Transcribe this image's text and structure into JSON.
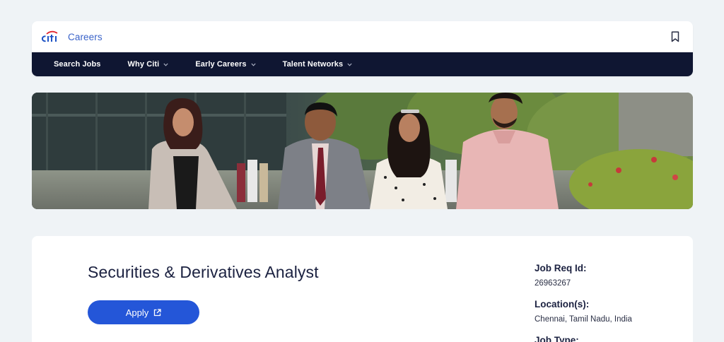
{
  "header": {
    "careers_label": "Careers",
    "logo_text": "citi"
  },
  "nav": {
    "items": [
      {
        "label": "Search Jobs",
        "has_dropdown": false
      },
      {
        "label": "Why Citi",
        "has_dropdown": true
      },
      {
        "label": "Early Careers",
        "has_dropdown": true
      },
      {
        "label": "Talent Networks",
        "has_dropdown": true
      }
    ]
  },
  "job": {
    "title": "Securities & Derivatives Analyst",
    "apply_label": "Apply",
    "meta": [
      {
        "label": "Job Req Id:",
        "value": "26963267"
      },
      {
        "label": "Location(s):",
        "value": "Chennai, Tamil Nadu, India"
      },
      {
        "label": "Job Type:",
        "value": ""
      }
    ]
  },
  "icons": {
    "bookmark": "bookmark-icon",
    "chevron": "chevron-down-icon",
    "external": "external-link-icon"
  },
  "colors": {
    "background": "#eff3f6",
    "nav_bg": "#0f1632",
    "brand_blue": "#2456d8",
    "careers_blue": "#3a63c9",
    "logo_red": "#e0262e",
    "text_dark": "#1b2140"
  }
}
